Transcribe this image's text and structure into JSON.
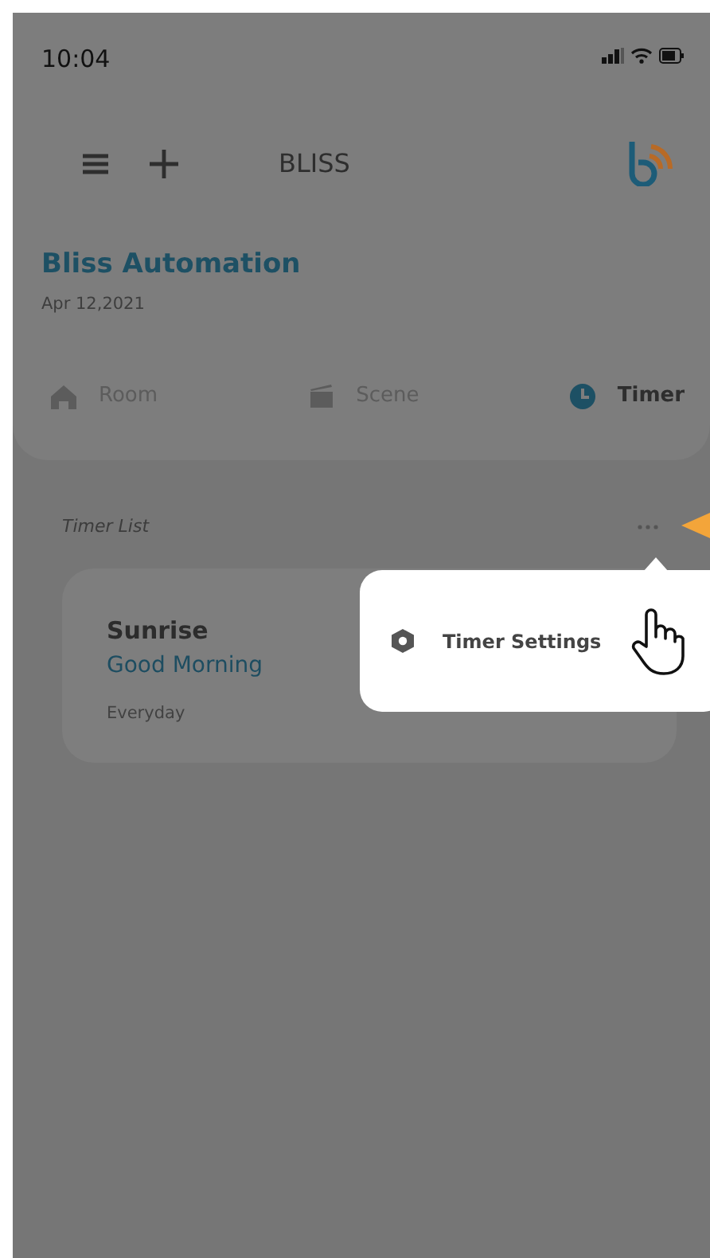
{
  "status_bar": {
    "time": "10:04"
  },
  "header": {
    "title": "BLISS"
  },
  "home": {
    "title": "Bliss Automation",
    "date": "Apr 12,2021"
  },
  "tabs": [
    {
      "label": "Room",
      "kind": "room",
      "selected": false
    },
    {
      "label": "Scene",
      "kind": "scene",
      "selected": false
    },
    {
      "label": "Timer",
      "kind": "timer",
      "selected": true
    }
  ],
  "section_title": "Timer List",
  "timers": [
    {
      "name": "Sunrise",
      "subtitle": "Good Morning",
      "repeat": "Everyday"
    }
  ],
  "popup_menu": {
    "items": [
      {
        "label": "Timer Settings"
      }
    ]
  },
  "overlay": {
    "dimmed": true
  }
}
